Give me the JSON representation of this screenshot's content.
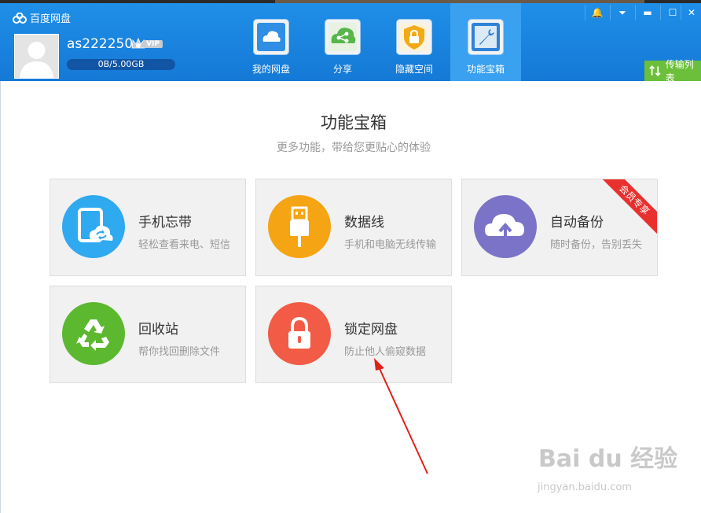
{
  "app": {
    "title": "百度网盘"
  },
  "user": {
    "name": "as222250",
    "vip_label": "VIP",
    "quota": "0B/5.00GB"
  },
  "nav": [
    {
      "label": "我的网盘",
      "icon": "cloud-icon"
    },
    {
      "label": "分享",
      "icon": "share-icon"
    },
    {
      "label": "隐藏空间",
      "icon": "lock-shield-icon"
    },
    {
      "label": "功能宝箱",
      "icon": "wrench-icon"
    }
  ],
  "transfer_label": "传输列表",
  "page": {
    "title": "功能宝箱",
    "subtitle": "更多功能，带给您更贴心的体验"
  },
  "cards": [
    {
      "title": "手机忘带",
      "desc": "轻松查看来电、短信",
      "color": "#2fa9f0",
      "icon": "phone-sync-icon"
    },
    {
      "title": "数据线",
      "desc": "手机和电脑无线传输",
      "color": "#f5a413",
      "icon": "usb-icon"
    },
    {
      "title": "自动备份",
      "desc": "随时备份，告别丢失",
      "color": "#7a73c7",
      "icon": "cloud-upload-icon",
      "ribbon": "会员专享"
    },
    {
      "title": "回收站",
      "desc": "帮你找回删除文件",
      "color": "#5cb82f",
      "icon": "recycle-icon"
    },
    {
      "title": "锁定网盘",
      "desc": "防止他人偷窥数据",
      "color": "#f25b45",
      "icon": "lock-icon"
    }
  ],
  "watermark": {
    "brand": "Bai du 经验",
    "url": "jingyan.baidu.com"
  }
}
